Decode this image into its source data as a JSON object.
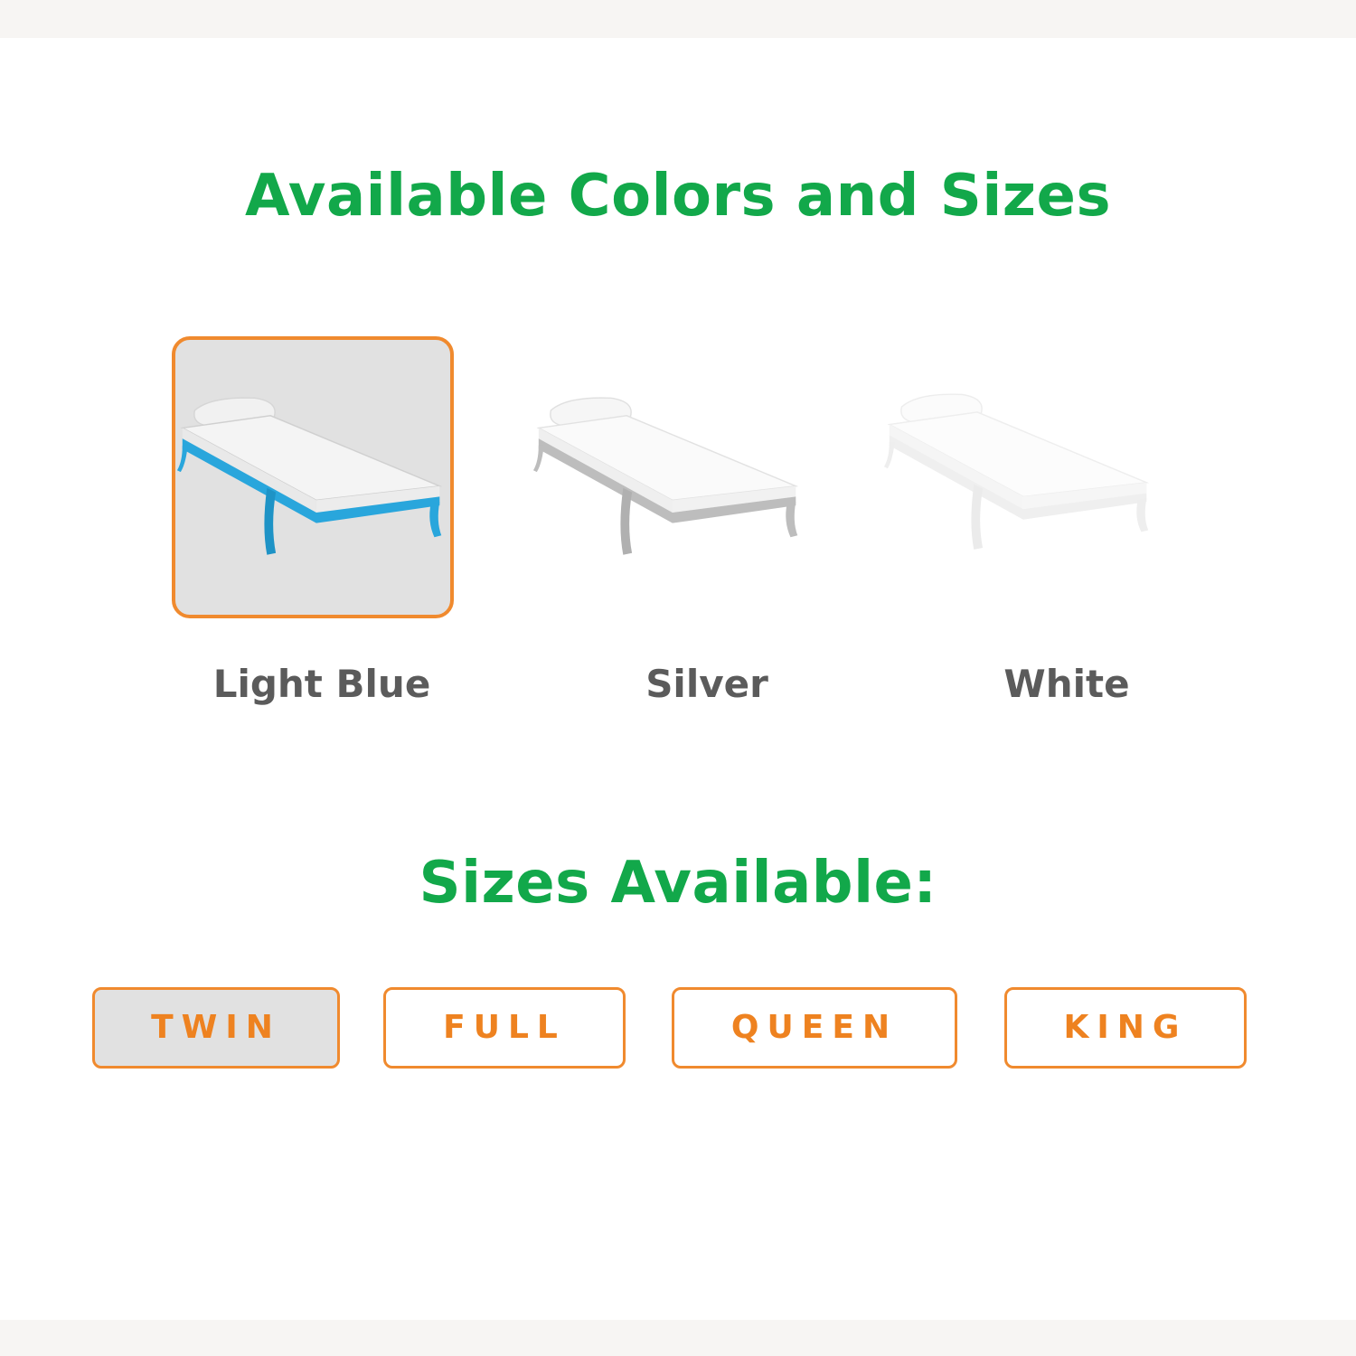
{
  "heading": "Available Colors and Sizes",
  "colors": [
    {
      "label": "Light Blue",
      "frame_color": "#29a6dc",
      "selected": true
    },
    {
      "label": "Silver",
      "frame_color": "#bdbdbd",
      "selected": false
    },
    {
      "label": "White",
      "frame_color": "#f2f2f2",
      "selected": false
    }
  ],
  "sizes_heading": "Sizes Available:",
  "sizes": [
    {
      "label": "TWIN",
      "selected": true
    },
    {
      "label": "FULL",
      "selected": false
    },
    {
      "label": "QUEEN",
      "selected": false
    },
    {
      "label": "KING",
      "selected": false
    }
  ],
  "accent_color": "#f08a2e",
  "heading_color": "#12a84a"
}
